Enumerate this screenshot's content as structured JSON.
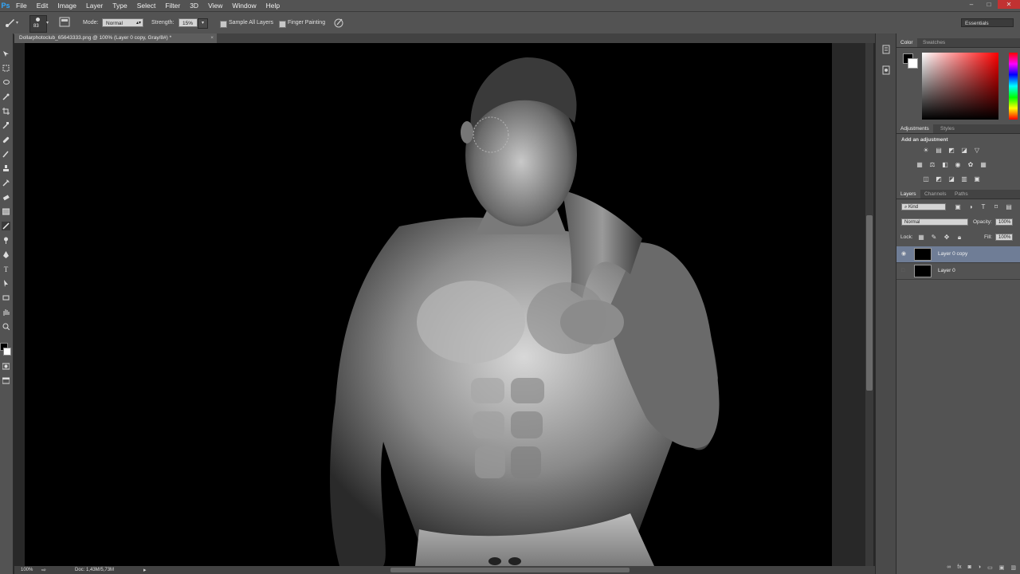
{
  "menubar": {
    "logo": "Ps",
    "items": [
      "File",
      "Edit",
      "Image",
      "Layer",
      "Type",
      "Select",
      "Filter",
      "3D",
      "View",
      "Window",
      "Help"
    ],
    "window_controls": [
      "–",
      "□",
      "✕"
    ]
  },
  "options": {
    "brush_size": "83",
    "mode_label": "Mode:",
    "mode_value": "Normal",
    "strength_label": "Strength:",
    "strength_value": "15%",
    "sample_all_layers": "Sample All Layers",
    "finger_painting": "Finger Painting",
    "workspace": "Essentials"
  },
  "document": {
    "tab_title": "Dollarphotoclub_65643333.png @ 100% (Layer 0 copy, Gray/8#) *",
    "close": "×"
  },
  "status": {
    "zoom": "100%",
    "doc_size": "Doc: 1,43M/5,73M"
  },
  "panels": {
    "color": {
      "tabs": [
        "Color",
        "Swatches"
      ],
      "active": "Color"
    },
    "adjustments": {
      "tabs": [
        "Adjustments",
        "Styles"
      ],
      "heading": "Add an adjustment"
    },
    "layers": {
      "tabs": [
        "Layers",
        "Channels",
        "Paths"
      ],
      "kind_label": "Kind",
      "blend_mode": "Normal",
      "opacity_label": "Opacity:",
      "opacity_value": "100%",
      "lock_label": "Lock:",
      "fill_label": "Fill:",
      "fill_value": "100%",
      "items": [
        {
          "name": "Layer 0 copy",
          "visible": true,
          "selected": true
        },
        {
          "name": "Layer 0",
          "visible": false,
          "selected": false
        }
      ]
    }
  },
  "colors": {
    "ui_bg": "#535353",
    "canvas_bg": "#000000",
    "selection": "#6f7d96",
    "accent_blue": "#31a8ff"
  }
}
